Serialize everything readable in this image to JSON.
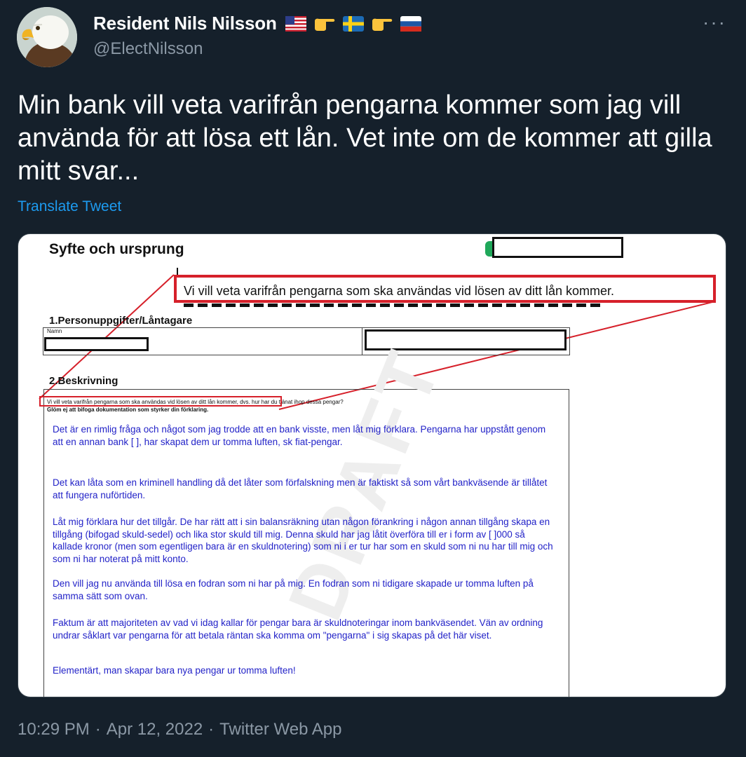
{
  "author": {
    "display_name": "Resident Nils Nilsson",
    "handle": "@ElectNilsson",
    "flag_icons": [
      "us-flag-icon",
      "pointing-right-icon",
      "sweden-flag-icon",
      "pointing-right-icon",
      "russia-flag-icon"
    ]
  },
  "more_glyph": "···",
  "tweet": {
    "text": "Min bank vill veta varifrån pengarna kommer som jag vill använda för att lösa ett lån. Vet inte om de kommer att gilla mitt svar...",
    "translate_label": "Translate Tweet"
  },
  "document": {
    "title": "Syfte och ursprung",
    "enlarged_question": "Vi vill veta varifrån pengarna som ska användas vid lösen av ditt lån kommer.",
    "section1_title": "1.Personuppgifter/Låntagare",
    "name_label": "Namn",
    "section2_title": "2.Beskrivning",
    "question_small": "Vi vill veta varifrån pengarna som ska användas vid lösen av ditt lån kommer, dvs. hur har du tjänat ihop dessa pengar?",
    "reminder": "Glöm ej att bifoga dokumentation som styrker din förklaring.",
    "answer_paragraphs": [
      "Det är en rimlig fråga och något som jag trodde att en bank visste, men låt mig förklara. Pengarna har uppstått genom att en annan bank [ ], har skapat dem ur tomma luften, sk fiat-pengar.",
      "Det kan låta som en kriminell handling då det låter som förfalskning men är faktiskt så som vårt bankväsende är tillåtet att fungera nuförtiden.",
      "Låt mig förklara hur det tillgår. De har rätt att i sin balansräkning utan någon förankring i någon annan tillgång skapa en tillgång (bifogad skuld-sedel) och lika stor skuld till mig. Denna skuld har jag låtit överföra till er i form av [ ]000 så kallade kronor (men som egentligen bara är en skuldnotering) som ni i er tur har som en skuld som ni nu har till mig och som ni har noterat på mitt konto.",
      "Den vill jag nu använda till lösa en fodran som ni har på mig. En fodran som ni tidigare skapade ur tomma luften på samma sätt som ovan.",
      "Faktum är att majoriteten av vad vi idag kallar för pengar bara är skuldnoteringar inom bankväsendet. Vän av ordning undrar såklart var pengarna för att betala räntan ska komma om \"pengarna\" i sig skapas på det här viset.",
      "Elementärt, man skapar bara nya pengar ur tomma luften!"
    ],
    "watermark": "DRAFT",
    "highlight_color": "#d6202a",
    "answer_color": "#2323c8"
  },
  "meta": {
    "time": "10:29 PM",
    "date": "Apr 12, 2022",
    "source": "Twitter Web App",
    "separator": "·"
  }
}
